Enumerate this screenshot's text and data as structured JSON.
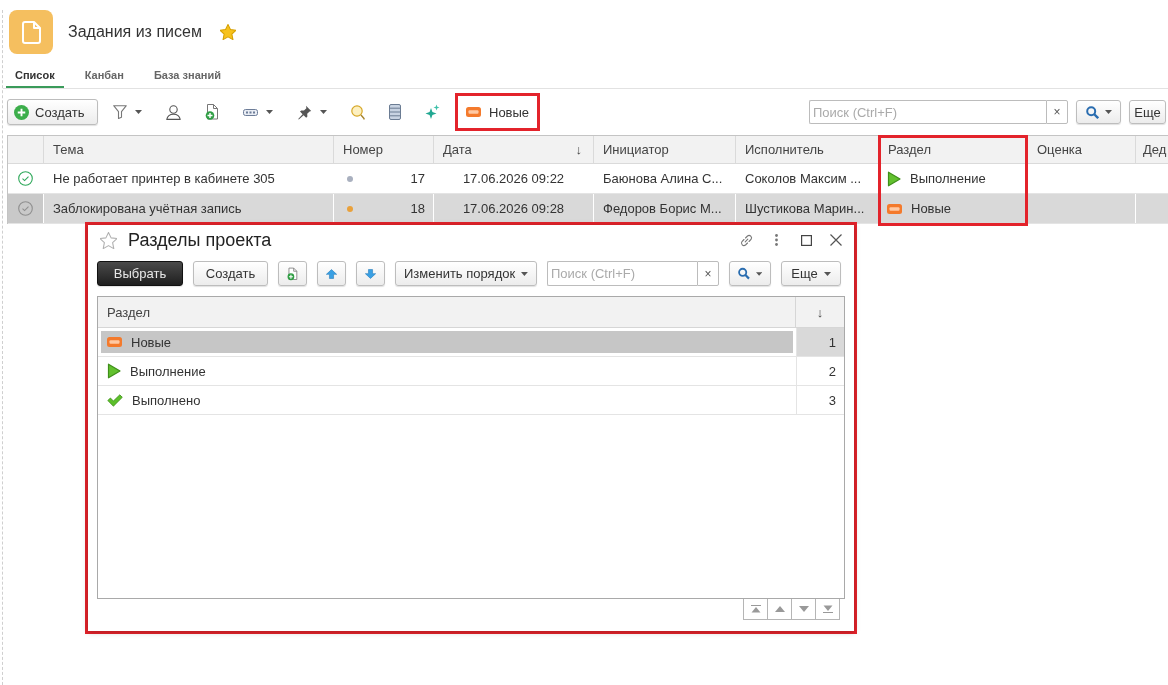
{
  "header": {
    "title": "Задания из писем",
    "favorite": true
  },
  "tabs": [
    {
      "label": "Список",
      "selected": true
    },
    {
      "label": "Канбан",
      "selected": false
    },
    {
      "label": "База знаний",
      "selected": false
    }
  ],
  "toolbar": {
    "create_button": "Создать",
    "tools": [
      {
        "kind": "filter",
        "dropdown": true
      },
      {
        "kind": "user",
        "dropdown": false
      },
      {
        "kind": "add_document",
        "dropdown": false
      },
      {
        "kind": "field",
        "dropdown": true
      },
      {
        "kind": "pin",
        "dropdown": true
      },
      {
        "kind": "lens",
        "dropdown": false
      },
      {
        "kind": "list",
        "dropdown": false
      },
      {
        "kind": "sparkle",
        "dropdown": false
      }
    ],
    "section_filter": {
      "kind": "new",
      "label": "Новые",
      "highlighted": true
    },
    "search": {
      "placeholder": "Поиск (Ctrl+F)",
      "clear": "×"
    },
    "more_button": "Еще"
  },
  "table": {
    "columns": [
      {
        "label": "Тема",
        "highlighted": false
      },
      {
        "label": "Номер",
        "highlighted": false
      },
      {
        "label": "Дата",
        "sort_mark": "↓",
        "highlighted": false
      },
      {
        "label": "Инициатор",
        "highlighted": false
      },
      {
        "label": "Исполнитель",
        "highlighted": false
      },
      {
        "label": "Раздел",
        "highlighted": true
      },
      {
        "label": "Оценка",
        "highlighted": false
      },
      {
        "label": "Дед",
        "highlighted": false
      }
    ],
    "rows": [
      {
        "selected": false,
        "topic": "Не работает принтер в кабинете 305",
        "color": "#a9b0bf",
        "number": "17",
        "date": "17.06.2026 09:22",
        "initiator": "Баюнова Алина С...",
        "executor": "Соколов Максим ...",
        "section": {
          "kind": "in_progress",
          "label": "Выполнение"
        }
      },
      {
        "selected": true,
        "topic": "Заблокирована учётная запись",
        "color": "#e9a13b",
        "number": "18",
        "date": "17.06.2026 09:28",
        "initiator": "Федоров Борис М...",
        "executor": "Шустикова Марин...",
        "section": {
          "kind": "new",
          "label": "Новые"
        }
      }
    ]
  },
  "dialog": {
    "title": "Разделы проекта",
    "favorite": false,
    "highlighted": true,
    "toolbar": {
      "select_button": "Выбрать",
      "create_button": "Создать",
      "tools": [
        {
          "kind": "add_document"
        },
        {
          "kind": "move_up"
        },
        {
          "kind": "move_down"
        }
      ],
      "reorder_button": "Изменить порядок",
      "search": {
        "placeholder": "Поиск (Ctrl+F)",
        "clear": "×"
      },
      "more_button": "Еще"
    },
    "table": {
      "columns": [
        {
          "label": "Раздел"
        },
        {
          "label": "↓"
        }
      ],
      "rows": [
        {
          "kind": "new",
          "label": "Новые",
          "order": "1",
          "selected": true
        },
        {
          "kind": "in_progress",
          "label": "Выполнение",
          "order": "2",
          "selected": false
        },
        {
          "kind": "done",
          "label": "Выполнено",
          "order": "3",
          "selected": false
        }
      ]
    }
  }
}
